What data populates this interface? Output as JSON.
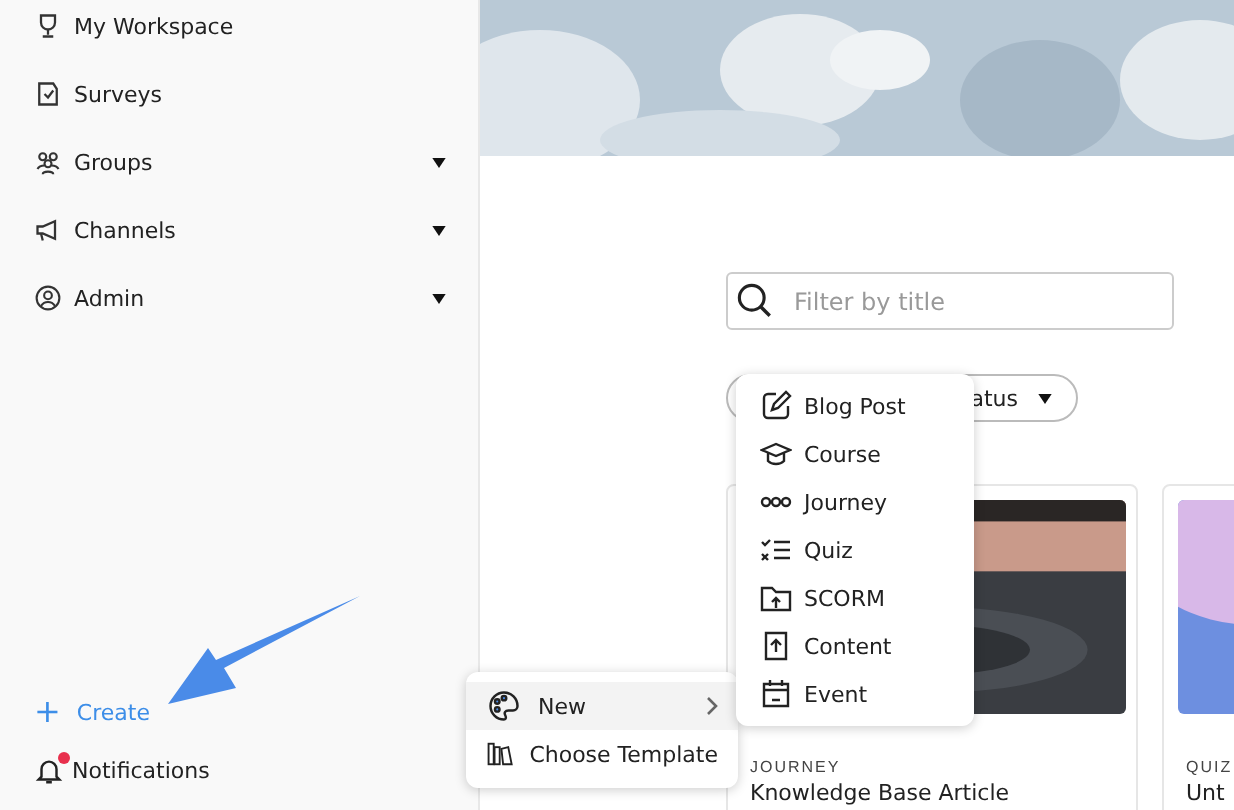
{
  "sidebar": {
    "items": [
      {
        "label": "My Workspace",
        "has_caret": false
      },
      {
        "label": "Surveys",
        "has_caret": false
      },
      {
        "label": "Groups",
        "has_caret": true
      },
      {
        "label": "Channels",
        "has_caret": true
      },
      {
        "label": "Admin",
        "has_caret": true
      }
    ],
    "create": {
      "icon": "+",
      "label": "Create"
    },
    "notifications": {
      "label": "Notifications",
      "unread": true
    }
  },
  "search": {
    "placeholder": "Filter by title"
  },
  "status_filter": {
    "label": "atus"
  },
  "cards": [
    {
      "kind_label": "JOURNEY",
      "title": "Knowledge Base Article"
    },
    {
      "kind_label": "QUIZ",
      "title": "Unt"
    }
  ],
  "create_menu": [
    {
      "label": "New",
      "selected": true,
      "submenu": true
    },
    {
      "label": "Choose Template",
      "selected": false,
      "submenu": false
    }
  ],
  "new_menu": [
    {
      "label": "Blog Post"
    },
    {
      "label": "Course"
    },
    {
      "label": "Journey"
    },
    {
      "label": "Quiz"
    },
    {
      "label": "SCORM"
    },
    {
      "label": "Content"
    },
    {
      "label": "Event"
    }
  ]
}
